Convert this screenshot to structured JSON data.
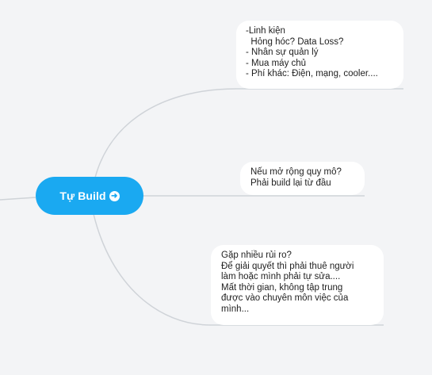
{
  "central_topic": {
    "label": "Tự Build",
    "icon": "expand-arrow-icon",
    "color": "#1aa9f1"
  },
  "subtopics": [
    {
      "lines": [
        "-Linh kiện",
        "  Hỏng hóc? Data Loss?",
        "- Nhân sự quản lý",
        "- Mua máy chủ",
        "- Phí khác: Điện, mạng, cooler...."
      ]
    },
    {
      "lines": [
        "Nếu mở rộng quy mô?",
        "Phải build lại từ đầu"
      ]
    },
    {
      "lines": [
        "Gặp nhiều rủi ro?",
        "Để giải quyết thì phải thuê người",
        "làm hoặc mình phải tự sửa....",
        "Mất thời gian, không tập trung",
        "được vào chuyên môn việc của",
        "mình..."
      ]
    }
  ],
  "colors": {
    "background": "#f3f4f6",
    "connector": "#cfd3d8",
    "node_background": "#ffffff"
  }
}
